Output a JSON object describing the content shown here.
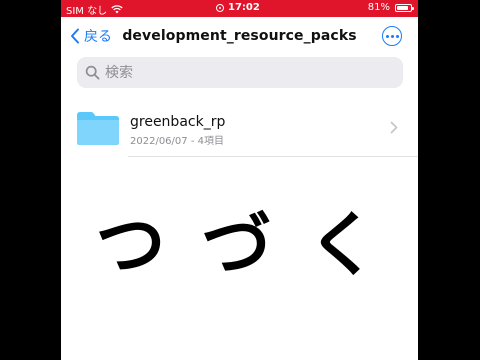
{
  "status_bar": {
    "carrier": "SIM なし",
    "time": "17:02",
    "battery": "81%",
    "accent_color": "#e0142a"
  },
  "nav": {
    "back_label": "戻る",
    "title": "development_resource_packs",
    "more_icon": "ellipsis-circle-icon"
  },
  "search": {
    "placeholder": "検索"
  },
  "items": [
    {
      "name": "greenback_rp",
      "meta": "2022/06/07 - 4項目",
      "icon": "folder-icon"
    }
  ],
  "overlay": {
    "caption": "つづく"
  },
  "colors": {
    "link": "#1a7cf5",
    "folder": "#5ac8fa"
  }
}
